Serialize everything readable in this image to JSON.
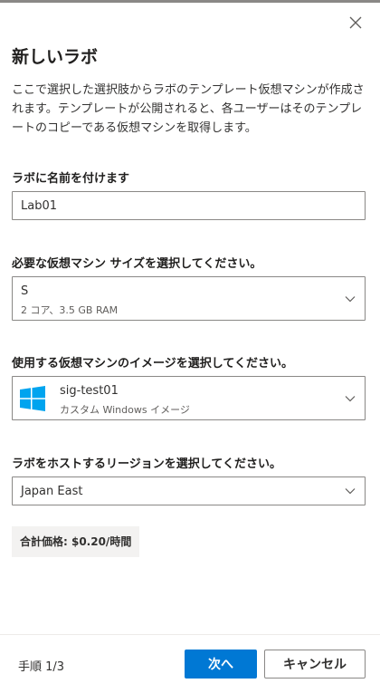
{
  "panel": {
    "title": "新しいラボ",
    "description": "ここで選択した選択肢からラボのテンプレート仮想マシンが作成されます。テンプレートが公開されると、各ユーザーはそのテンプレートのコピーである仮想マシンを取得します。"
  },
  "lab_name": {
    "label": "ラボに名前を付けます",
    "value": "Lab01"
  },
  "vm_size": {
    "label": "必要な仮想マシン サイズを選択してください。",
    "selected": "S",
    "detail": "2 コア、3.5 GB RAM"
  },
  "vm_image": {
    "label": "使用する仮想マシンのイメージを選択してください。",
    "selected": "sig-test01",
    "detail": "カスタム Windows イメージ",
    "icon": "windows-logo-icon",
    "icon_color": "#00a4ef"
  },
  "region": {
    "label": "ラボをホストするリージョンを選択してください。",
    "selected": "Japan East"
  },
  "price": {
    "text": "合計価格: $0.20/時間"
  },
  "footer": {
    "step": "手順 1/3",
    "next_label": "次へ",
    "cancel_label": "キャンセル"
  },
  "colors": {
    "primary": "#0078d4",
    "border": "#8a8886",
    "price_bg": "#f3f2f1"
  }
}
